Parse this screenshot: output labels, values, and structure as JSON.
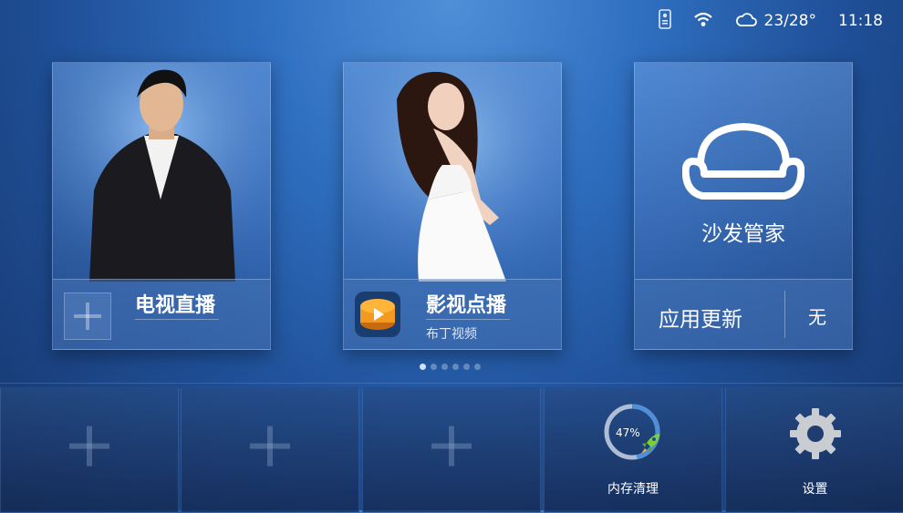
{
  "status": {
    "remote_icon": "remote-control-icon",
    "wifi_icon": "wifi-icon",
    "weather_icon": "cloud-icon",
    "temperature": "23/28°",
    "time": "11:18"
  },
  "tiles": [
    {
      "title": "电视直播",
      "add_icon": "plus-icon"
    },
    {
      "title": "影视点播",
      "subtitle": "布丁视频",
      "app_icon": "pudding-video-icon"
    },
    {
      "title": "沙发管家",
      "update_label": "应用更新",
      "update_value": "无",
      "icon": "sofa-icon"
    }
  ],
  "pager": {
    "total": 6,
    "active": 0
  },
  "bottom": {
    "memory": {
      "label": "内存清理",
      "percent": "47%",
      "value": 0.47,
      "icon": "rocket-icon"
    },
    "settings": {
      "label": "设置",
      "icon": "gear-icon"
    },
    "empty_slots": 3
  },
  "colors": {
    "accent": "#4f8fd8",
    "progress_track": "#c8d4e4",
    "rocket": "#7ccf3a",
    "pudding_orange": "#f39a1e"
  }
}
